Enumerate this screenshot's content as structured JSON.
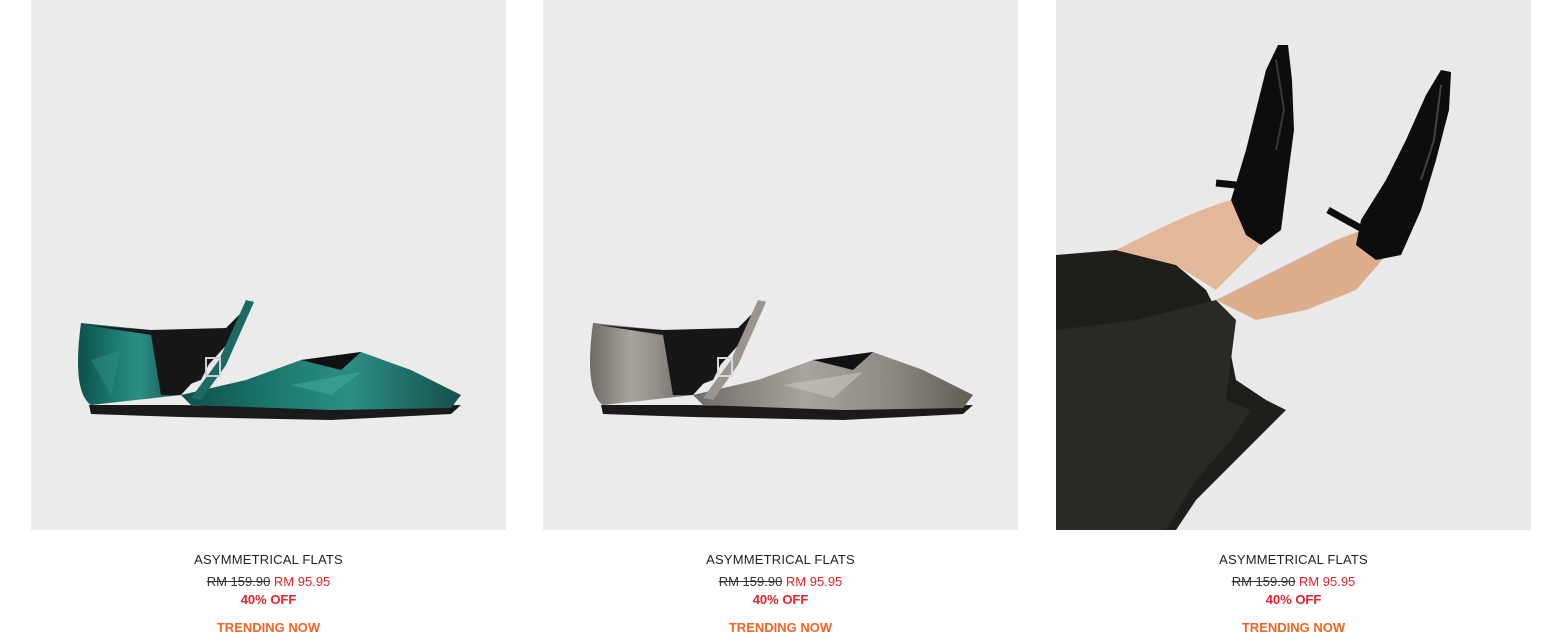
{
  "products": [
    {
      "name": "ASYMMETRICAL FLATS",
      "old_price": "RM 159.90",
      "new_price": "RM 95.95",
      "discount": "40% OFF",
      "badge": "TRENDING NOW",
      "color": "#1f6f67",
      "image": "green-metallic-flat-image"
    },
    {
      "name": "ASYMMETRICAL FLATS",
      "old_price": "RM 159.90",
      "new_price": "RM 95.95",
      "discount": "40% OFF",
      "badge": "TRENDING NOW",
      "color": "#8f8a84",
      "image": "silver-metallic-flat-image"
    },
    {
      "name": "ASYMMETRICAL FLATS",
      "old_price": "RM 159.90",
      "new_price": "RM 95.95",
      "discount": "40% OFF",
      "badge": "TRENDING NOW",
      "color": "#111111",
      "image": "black-patent-flat-worn-image"
    }
  ],
  "colors": {
    "sale_red": "#e8222a",
    "badge_orange": "#f26522",
    "image_bg": "#ebebeb"
  }
}
